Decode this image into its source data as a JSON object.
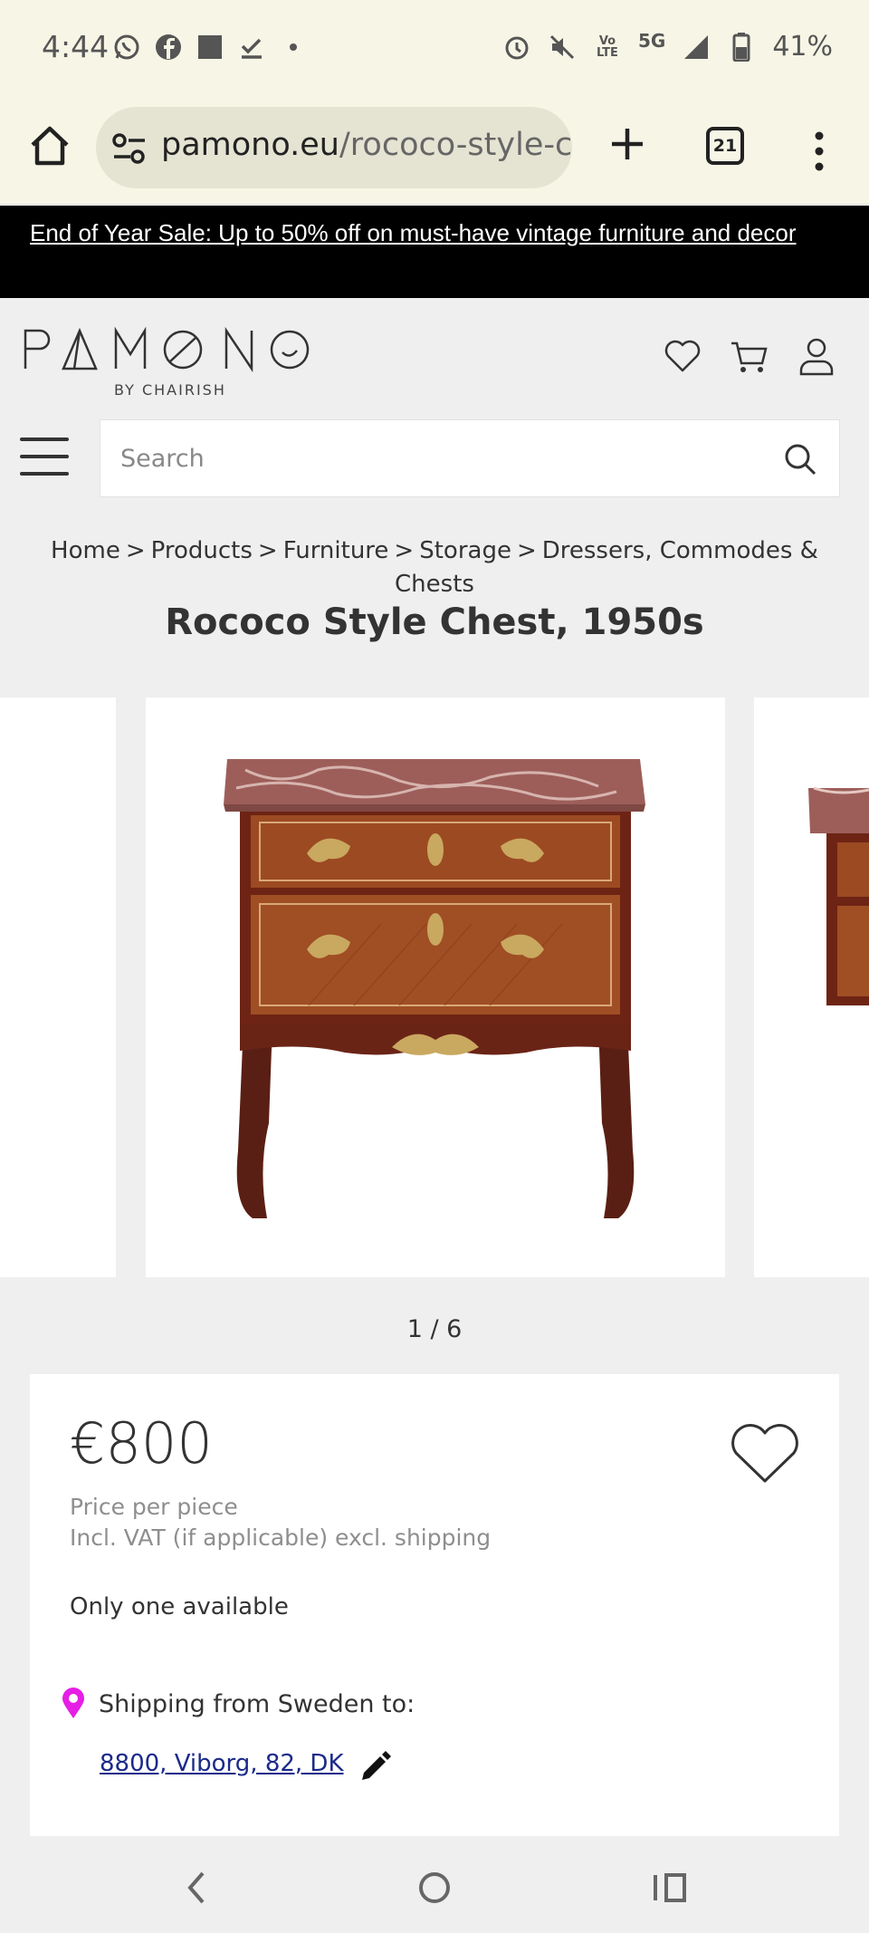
{
  "status_bar": {
    "time": "4:44",
    "battery": "41%",
    "network": "5G",
    "left_icons": [
      "whatsapp-icon",
      "facebook-icon",
      "square-icon",
      "download-done-icon",
      "dot-icon"
    ],
    "right_icons": [
      "alarm-icon",
      "mute-icon",
      "volte-icon",
      "signal-icon",
      "battery-icon"
    ]
  },
  "browser": {
    "url_domain": "pamono.eu",
    "url_path": "/rococo-style-cl",
    "tab_count": "21"
  },
  "promo": {
    "text": "End of Year Sale: Up to 50% off on must-have vintage furniture and decor"
  },
  "header": {
    "logo": "PAMONO",
    "logo_sub": "BY CHAIRISH"
  },
  "search": {
    "placeholder": "Search"
  },
  "breadcrumb": {
    "items": [
      "Home",
      "Products",
      "Furniture",
      "Storage",
      "Dressers, Commodes & Chests"
    ],
    "separator": ">"
  },
  "product": {
    "title": "Rococo Style Chest, 1950s",
    "gallery_counter": "1 / 6",
    "price": "€800",
    "price_per": "Price per piece",
    "price_note": "Incl. VAT (if applicable) excl. shipping",
    "availability": "Only one available",
    "shipping_label": "Shipping from Sweden to:",
    "shipping_destination": "8800, Viborg, 82, DK"
  },
  "colors": {
    "promo_bg": "#000000",
    "browser_bg": "#f7f6e6",
    "page_bg": "#efefef",
    "link_blue": "#1b2a8a",
    "pin_magenta": "#e61ee6"
  }
}
